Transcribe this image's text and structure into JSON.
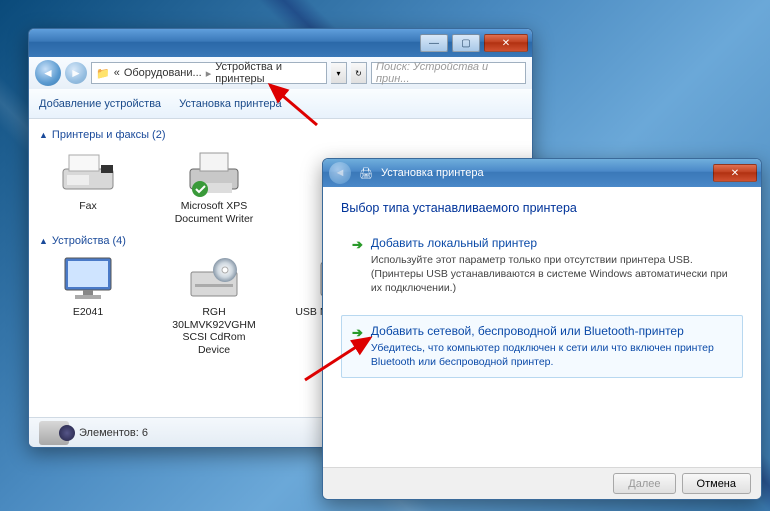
{
  "explorer": {
    "breadcrumb": {
      "part1": "Оборудовани...",
      "part2": "Устройства и принтеры"
    },
    "search_placeholder": "Поиск: Устройства и прин...",
    "toolbar": {
      "add_device": "Добавление устройства",
      "add_printer": "Установка принтера"
    },
    "groups": {
      "printers": {
        "title": "Принтеры и факсы (2)"
      },
      "devices": {
        "title": "Устройства (4)"
      }
    },
    "printers": [
      {
        "label": "Fax"
      },
      {
        "label": "Microsoft XPS Document Writer"
      }
    ],
    "devices": [
      {
        "label": "E2041"
      },
      {
        "label": "RGH 30LMVK92VGHM SCSI CdRom Device"
      },
      {
        "label": "USB Mass Storage Device"
      }
    ],
    "status": {
      "text": "Элементов: 6"
    }
  },
  "wizard": {
    "title": "Установка принтера",
    "heading": "Выбор типа устанавливаемого принтера",
    "options": [
      {
        "title": "Добавить локальный принтер",
        "desc": "Используйте этот параметр только при отсутствии принтера USB. (Принтеры USB устанавливаются в системе Windows автоматически при их подключении.)"
      },
      {
        "title": "Добавить сетевой, беспроводной или Bluetooth-принтер",
        "desc": "Убедитесь, что компьютер подключен к сети или что включен принтер Bluetooth или беспроводной принтер."
      }
    ],
    "buttons": {
      "next": "Далее",
      "cancel": "Отмена"
    },
    "icon_name": "printer-icon"
  }
}
